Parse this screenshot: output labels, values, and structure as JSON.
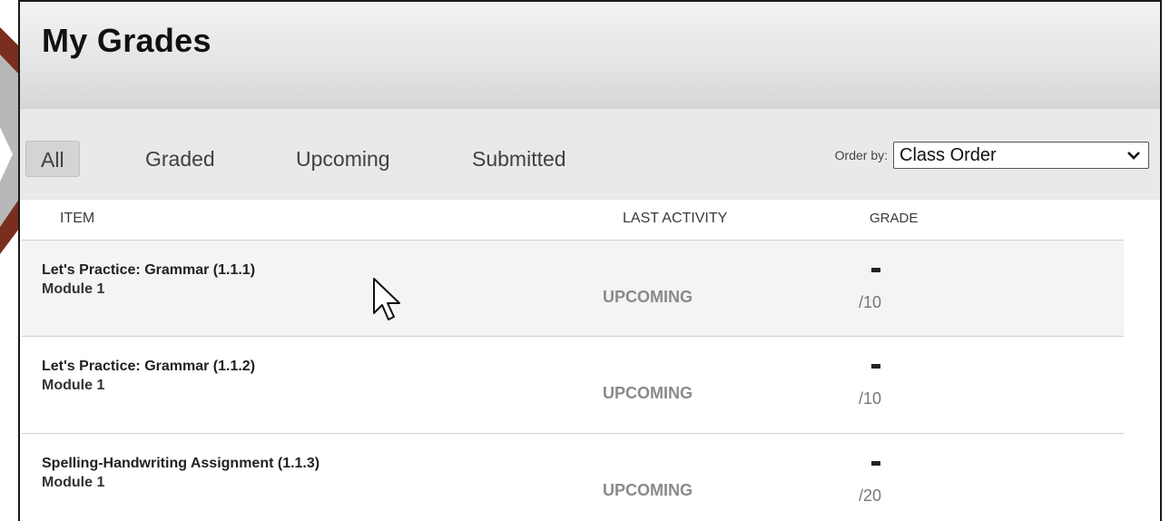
{
  "page": {
    "title": "My Grades"
  },
  "tabs": [
    {
      "label": "All",
      "active": true
    },
    {
      "label": "Graded",
      "active": false
    },
    {
      "label": "Upcoming",
      "active": false
    },
    {
      "label": "Submitted",
      "active": false
    }
  ],
  "order_by": {
    "label": "Order by:",
    "value": "Class Order",
    "icon": "chevron-down-icon"
  },
  "columns": {
    "item": "ITEM",
    "last_activity": "LAST ACTIVITY",
    "grade": "GRADE"
  },
  "rows": [
    {
      "title": "Let's Practice: Grammar (1.1.1)",
      "module": "Module 1",
      "status": "UPCOMING",
      "grade": "-",
      "max": "/10"
    },
    {
      "title": "Let's Practice: Grammar (1.1.2)",
      "module": "Module 1",
      "status": "UPCOMING",
      "grade": "-",
      "max": "/10"
    },
    {
      "title": "Spelling-Handwriting Assignment (1.1.3)",
      "module": "Module 1",
      "status": "UPCOMING",
      "grade": "-",
      "max": "/20"
    }
  ],
  "colors": {
    "header_bg": "#e4e4e4",
    "filterbar_bg": "#e9e9e9",
    "status_text": "#8a8a8a",
    "decor_brown": "#7a2f1e"
  }
}
